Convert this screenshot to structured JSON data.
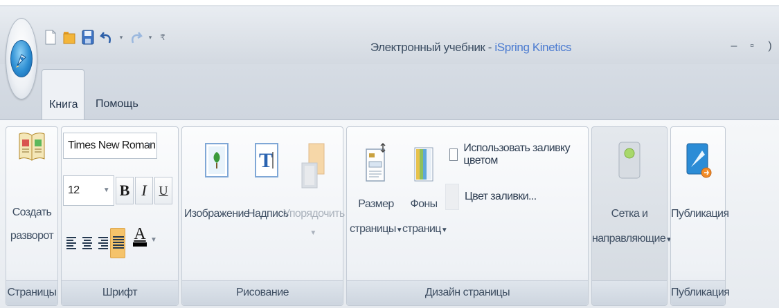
{
  "window": {
    "title_prefix": "Электронный учебник - ",
    "title_brand": "iSpring Kinetics",
    "controls": [
      "–",
      "▫",
      ")"
    ]
  },
  "quick_access": {
    "icons": [
      "new-document-icon",
      "open-folder-icon",
      "save-icon",
      "undo-icon",
      "redo-icon",
      "customize-qat-icon"
    ]
  },
  "tabs": [
    {
      "label": "Книга",
      "active": true
    },
    {
      "label": "Помощь",
      "active": false
    }
  ],
  "groups": {
    "pages": {
      "label": "Страницы",
      "create_spread": {
        "line1": "Создать",
        "line2": "разворот"
      }
    },
    "font": {
      "label": "Шрифт",
      "font_name": "Times New Roman",
      "font_size": "12",
      "bold": "B",
      "italic": "I",
      "underline": "U",
      "font_color_letter": "A",
      "font_color": "#000000"
    },
    "drawing": {
      "label": "Рисование",
      "image": "Изображение",
      "caption": "Надпись",
      "arrange": "Упорядочить"
    },
    "page_design": {
      "label": "Дизайн страницы",
      "page_size": {
        "line1": "Размер",
        "line2": "страницы"
      },
      "page_backgrounds": {
        "line1": "Фоны",
        "line2": "страниц"
      },
      "use_color_fill": "Использовать заливку цветом",
      "fill_color": "Цвет заливки..."
    },
    "grid": {
      "label": "",
      "grid_guides": {
        "line1": "Сетка и",
        "line2": "направляющие"
      }
    },
    "publish": {
      "label": "Публикация",
      "publish_btn": "Публикация"
    }
  },
  "colors": {
    "accent_brand": "#4a7ad0",
    "ribbon_bg": "#eef1f5",
    "active_align": "#f5c36a"
  }
}
